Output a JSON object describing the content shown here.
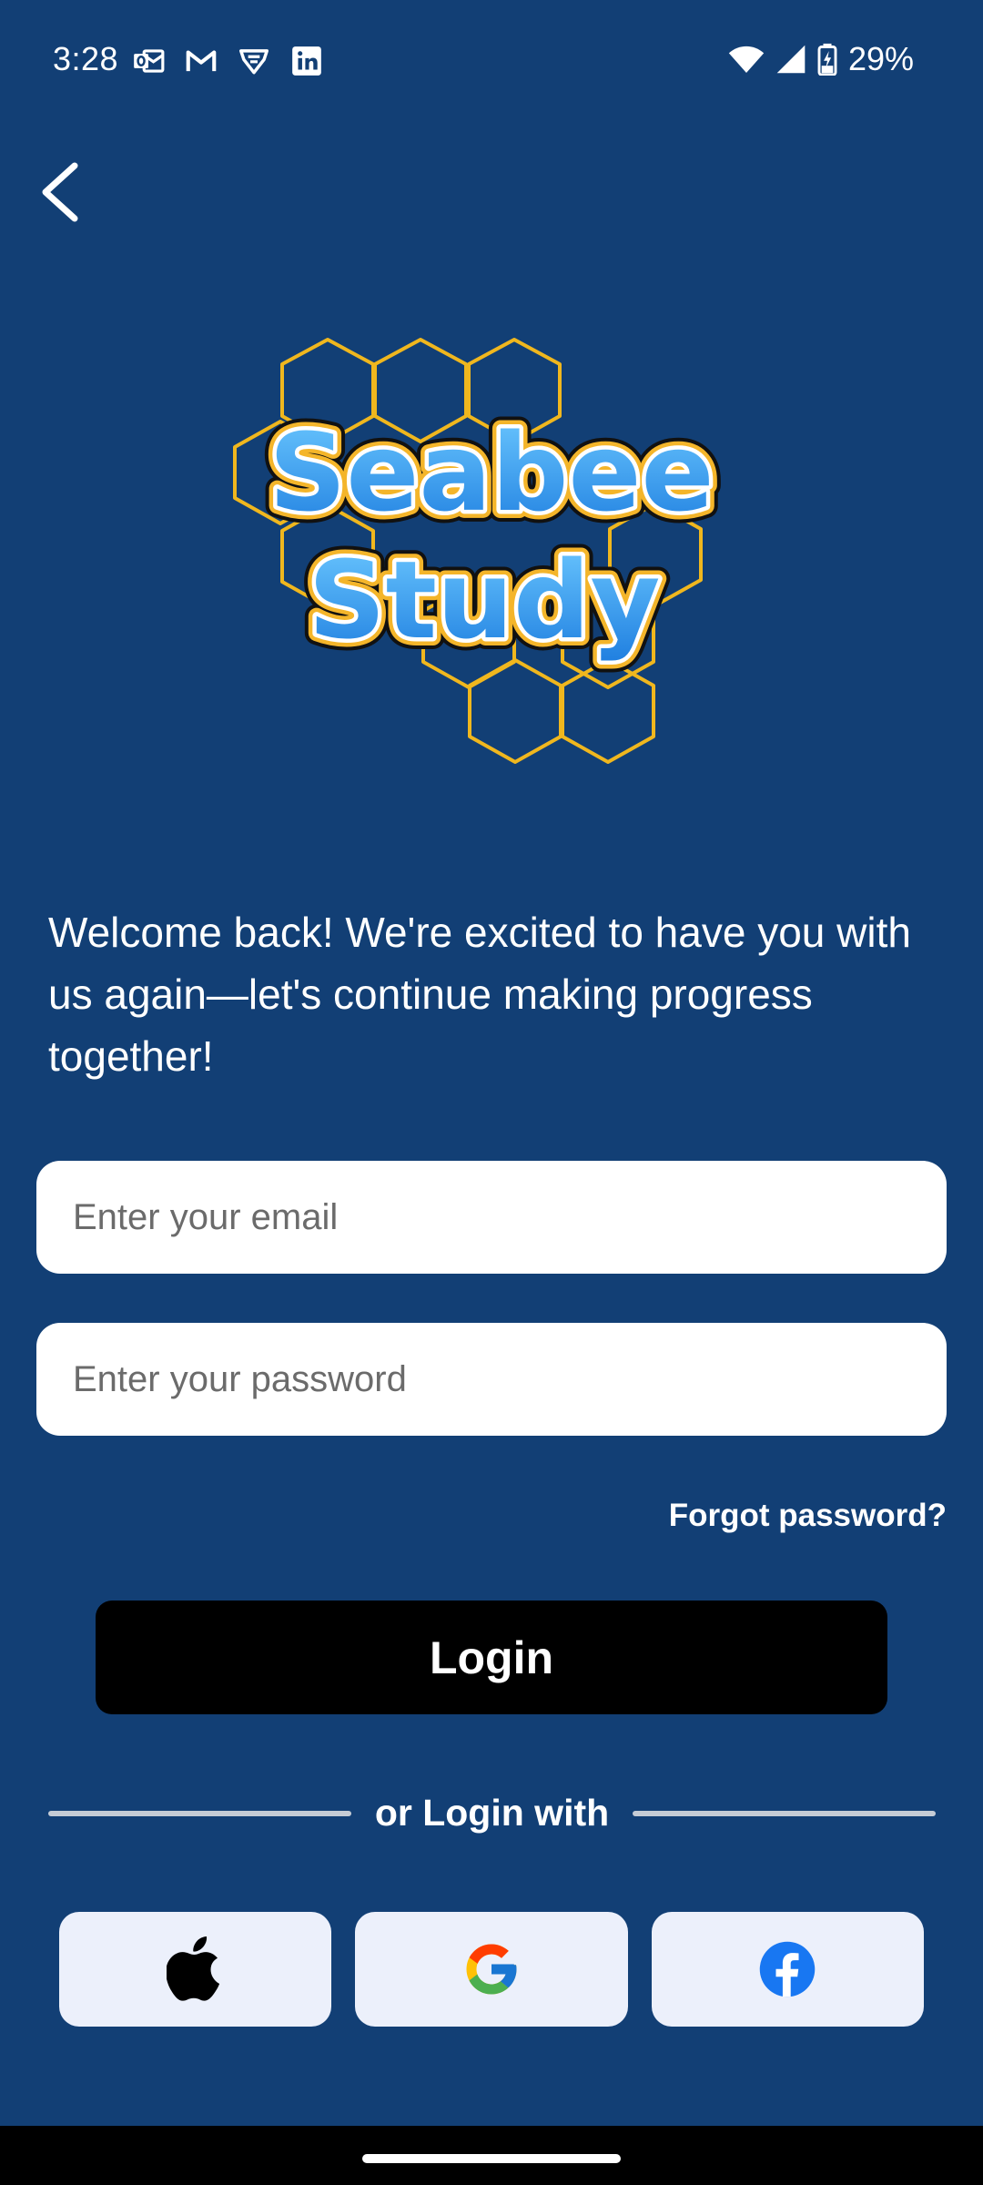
{
  "status_bar": {
    "time": "3:28",
    "notification_icons": [
      "outlook-icon",
      "gmail-icon",
      "vpn-icon",
      "linkedin-icon"
    ],
    "battery_percent": "29%"
  },
  "logo": {
    "line1": "Seabee",
    "line2": "Study"
  },
  "welcome_text": "Welcome back! We're excited to have you with us again—let's continue making progress together!",
  "email": {
    "value": "",
    "placeholder": "Enter your email"
  },
  "password": {
    "value": "",
    "placeholder": "Enter your password"
  },
  "forgot_password_label": "Forgot password?",
  "login_label": "Login",
  "divider_label": "or Login with",
  "social": [
    {
      "icon": "apple-icon"
    },
    {
      "icon": "google-icon"
    },
    {
      "icon": "facebook-icon"
    }
  ],
  "colors": {
    "background": "#123f75",
    "login_button": "#000000",
    "social_button": "#ecf0fb",
    "honeycomb": "#f0b71e",
    "logo_blue": "#2a9ff0"
  }
}
